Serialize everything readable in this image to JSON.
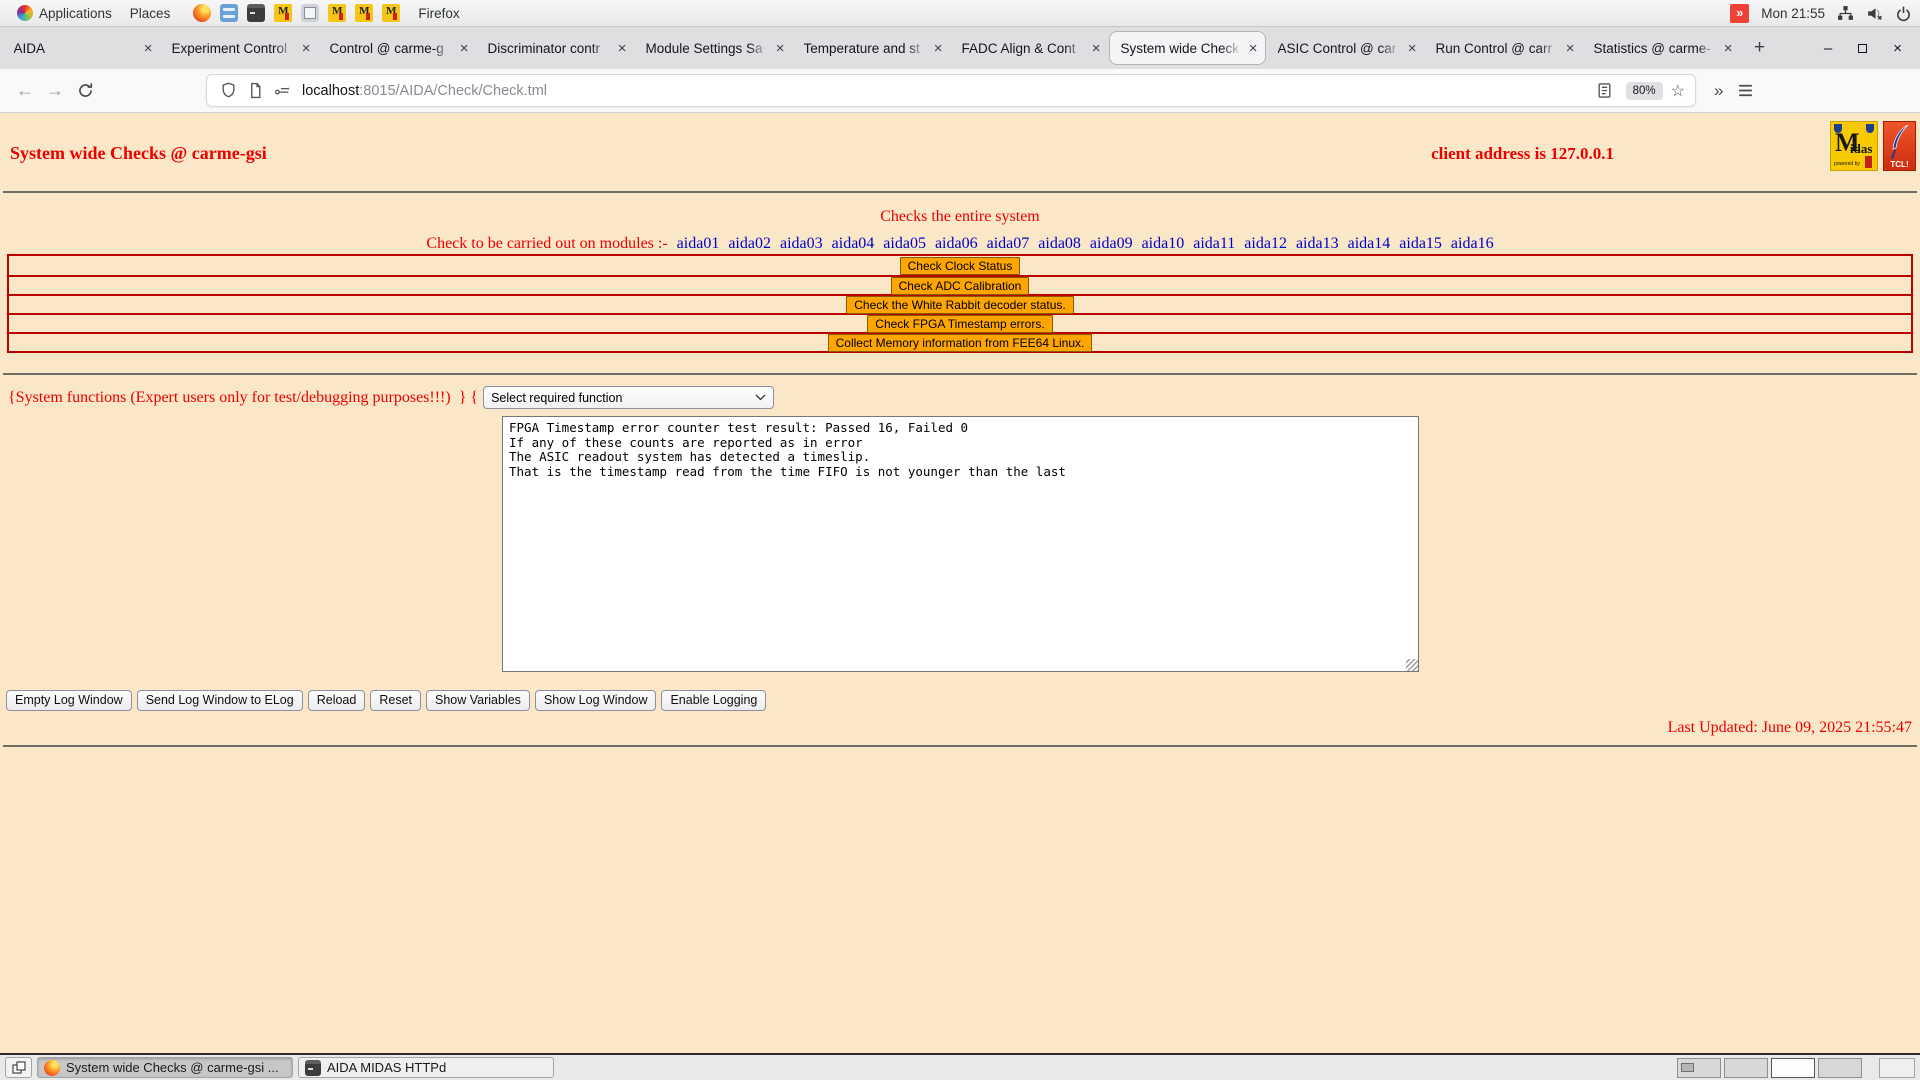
{
  "icons": {
    "tab_close": "×",
    "new_tab": "+",
    "back": "←",
    "forward": "→",
    "star": "☆",
    "overflow": "»",
    "notification": "»",
    "window_minimize": "–",
    "window_close": "×",
    "midas_mini": "M"
  },
  "top_bar": {
    "applications_label": "Applications",
    "places_label": "Places",
    "window_title": "Firefox",
    "clock": "Mon 21:55"
  },
  "browser": {
    "tabs": [
      {
        "label": "AIDA"
      },
      {
        "label": "Experiment Control"
      },
      {
        "label": "Control @ carme-g"
      },
      {
        "label": "Discriminator contr"
      },
      {
        "label": "Module Settings Sa"
      },
      {
        "label": "Temperature and st"
      },
      {
        "label": "FADC Align & Cont"
      },
      {
        "label": "System wide Check"
      },
      {
        "label": "ASIC Control @ car"
      },
      {
        "label": "Run Control @ carr"
      },
      {
        "label": "Statistics @ carme-"
      }
    ],
    "url": {
      "host": "localhost",
      "path": ":8015/AIDA/Check/Check.tml"
    },
    "zoom_level": "80%"
  },
  "page": {
    "title": "System wide Checks @ carme-gsi",
    "client_address": "client address is 127.0.0.1",
    "subtitle": "Checks the entire system",
    "modules_prefix": "Check to be carried out on modules :-",
    "modules": [
      "aida01",
      "aida02",
      "aida03",
      "aida04",
      "aida05",
      "aida06",
      "aida07",
      "aida08",
      "aida09",
      "aida10",
      "aida11",
      "aida12",
      "aida13",
      "aida14",
      "aida15",
      "aida16"
    ],
    "check_buttons": [
      "Check Clock Status",
      "Check ADC Calibration",
      "Check the White Rabbit decoder status.",
      "Check FPGA Timestamp errors.",
      "Collect Memory information from FEE64 Linux."
    ],
    "system_functions_label": "{System functions (Expert users only for test/debugging purposes!!!)  } {",
    "function_select": {
      "value": "Select required function"
    },
    "log_window": "FPGA Timestamp error counter test result: Passed 16, Failed 0\nIf any of these counts are reported as in error\nThe ASIC readout system has detected a timeslip.\nThat is the timestamp read from the time FIFO is not younger than the last",
    "log_buttons": [
      "Empty Log Window",
      "Send Log Window to ELog",
      "Reload",
      "Reset",
      "Show Variables",
      "Show Log Window",
      "Enable Logging"
    ],
    "last_updated": "Last Updated: June 09, 2025 21:55:47",
    "logos": {
      "midas_m": "M",
      "midas_rest": "idas",
      "midas_sub": "powered by",
      "tcl": "TCL!"
    }
  },
  "taskbar": {
    "tasks": [
      {
        "label": "System wide Checks @ carme-gsi ..."
      },
      {
        "label": "AIDA MIDAS HTTPd"
      }
    ]
  },
  "colors": {
    "page_bg": "#fae7c8",
    "accent_red": "#ee0000",
    "module_blue": "#0000cc",
    "row_border": "#bb0000",
    "button_orange": "#ffa500"
  }
}
